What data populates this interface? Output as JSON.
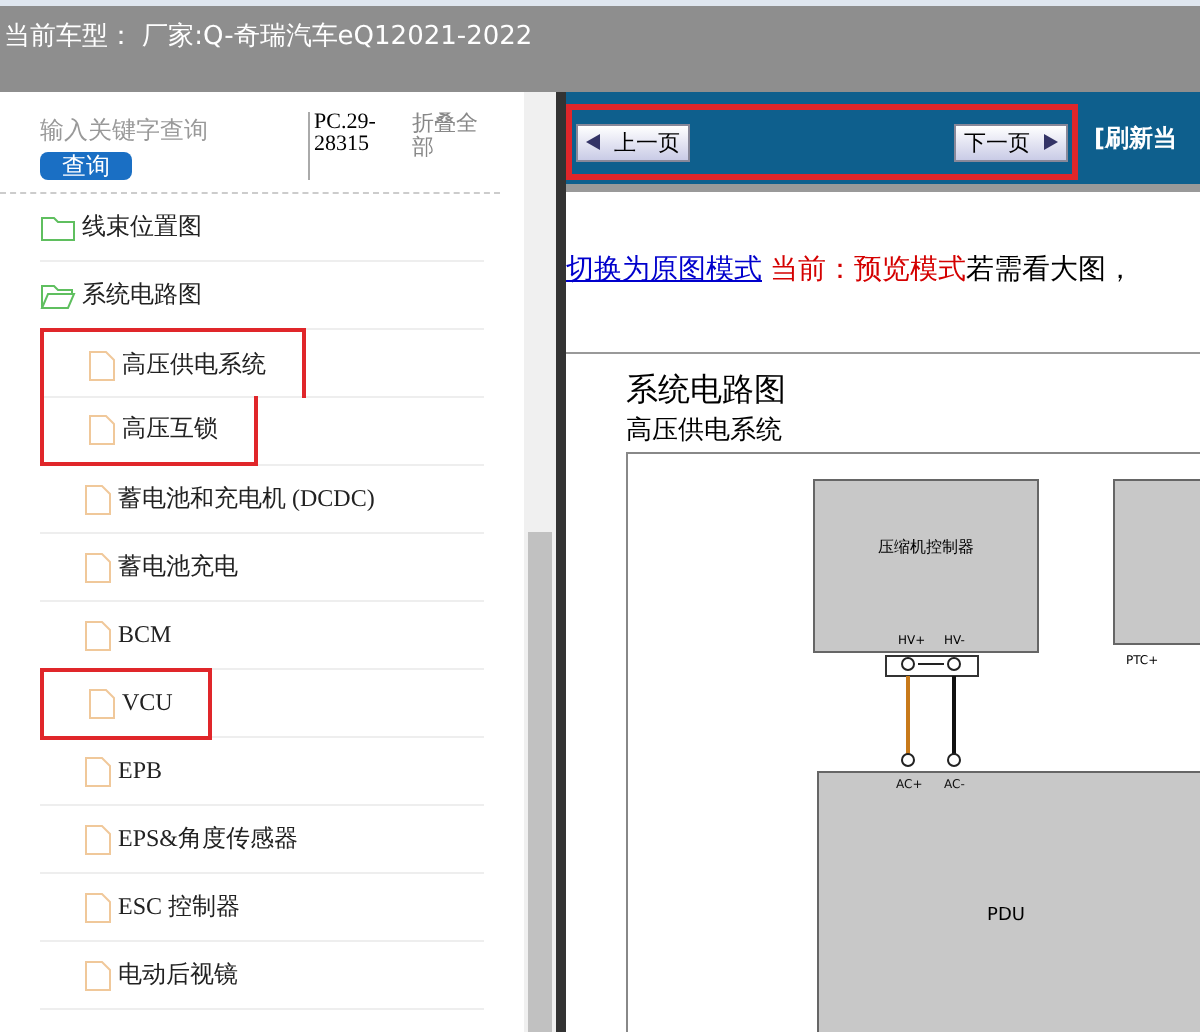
{
  "header": {
    "title": "当前车型： 厂家:Q-奇瑞汽车eQ12021-2022"
  },
  "sidebar": {
    "search": {
      "placeholder": "输入关键字查询",
      "button": "查询"
    },
    "code": "PC.29-28315",
    "collapse": "折叠全部",
    "tree": [
      {
        "label": "线束位置图",
        "kind": "folder",
        "expanded": false,
        "boxed": false
      },
      {
        "label": "系统电路图",
        "kind": "folder",
        "expanded": true,
        "boxed": false,
        "children": [
          {
            "label": "高压供电系统",
            "kind": "file",
            "boxed": true
          },
          {
            "label": "高压互锁",
            "kind": "file",
            "boxed": true
          },
          {
            "label": "蓄电池和充电机 (DCDC)",
            "kind": "file",
            "boxed": false
          },
          {
            "label": "蓄电池充电",
            "kind": "file",
            "boxed": false
          },
          {
            "label": "BCM",
            "kind": "file",
            "boxed": false
          },
          {
            "label": "VCU",
            "kind": "file",
            "boxed": true
          },
          {
            "label": "EPB",
            "kind": "file",
            "boxed": false
          },
          {
            "label": "EPS&角度传感器",
            "kind": "file",
            "boxed": false
          },
          {
            "label": "ESC 控制器",
            "kind": "file",
            "boxed": false
          },
          {
            "label": "电动后视镜",
            "kind": "file",
            "boxed": false
          }
        ]
      }
    ]
  },
  "toolbar": {
    "prev": "上一页",
    "next": "下一页",
    "refresh": "[刷新当",
    "boxed": true
  },
  "mode_line": {
    "link": "切换为原图模式",
    "current": "当前：预览模式",
    "hint": "若需看大图，"
  },
  "document": {
    "title": "系统电路图",
    "subtitle": "高压供电系统",
    "diagram": {
      "compressor": "压缩机控制器",
      "hv_plus": "HV+",
      "hv_minus": "HV-",
      "ac_plus": "AC+",
      "ac_minus": "AC-",
      "ptc_plus": "PTC+",
      "pdu": "PDU"
    }
  }
}
